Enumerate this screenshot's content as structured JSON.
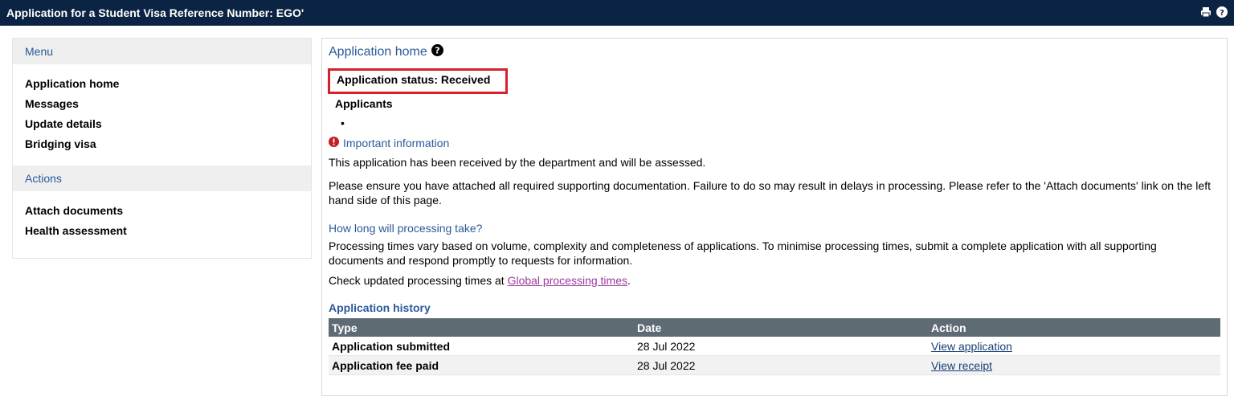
{
  "header": {
    "title": "Application for a Student Visa Reference Number: EGO'",
    "print_icon": "print-icon",
    "help_icon": "help-icon"
  },
  "sidebar": {
    "menu_title": "Menu",
    "menu_items": [
      "Application home",
      "Messages",
      "Update details",
      "Bridging visa"
    ],
    "actions_title": "Actions",
    "action_items": [
      "Attach documents",
      "Health assessment"
    ]
  },
  "main": {
    "title": "Application home",
    "status_label": "Application status: Received",
    "applicants_label": "Applicants",
    "bullet": "•",
    "important_label": "Important information",
    "received_text": "This application has been received by the department and will be assessed.",
    "ensure_text": "Please ensure you have attached all required supporting documentation. Failure to do so may result in delays in processing. Please refer to the 'Attach documents' link on the left hand side of this page.",
    "processing_link": "How long will processing take?",
    "processing_text": "Processing times vary based on volume, complexity and completeness of applications. To minimise processing times, submit a complete application with all supporting documents and respond promptly to requests for information.",
    "check_prefix": "Check updated processing times at ",
    "global_link": "Global processing times",
    "check_suffix": ".",
    "history_title": "Application history",
    "table": {
      "headers": [
        "Type",
        "Date",
        "Action"
      ],
      "rows": [
        {
          "type": "Application submitted",
          "date": "28 Jul 2022",
          "action": "View application"
        },
        {
          "type": "Application fee paid",
          "date": "28 Jul 2022",
          "action": "View receipt"
        }
      ]
    }
  },
  "colors": {
    "topbar": "#0c2444",
    "accent": "#2a5a9a",
    "status_border": "#d6212a",
    "table_header": "#5f6b73"
  }
}
